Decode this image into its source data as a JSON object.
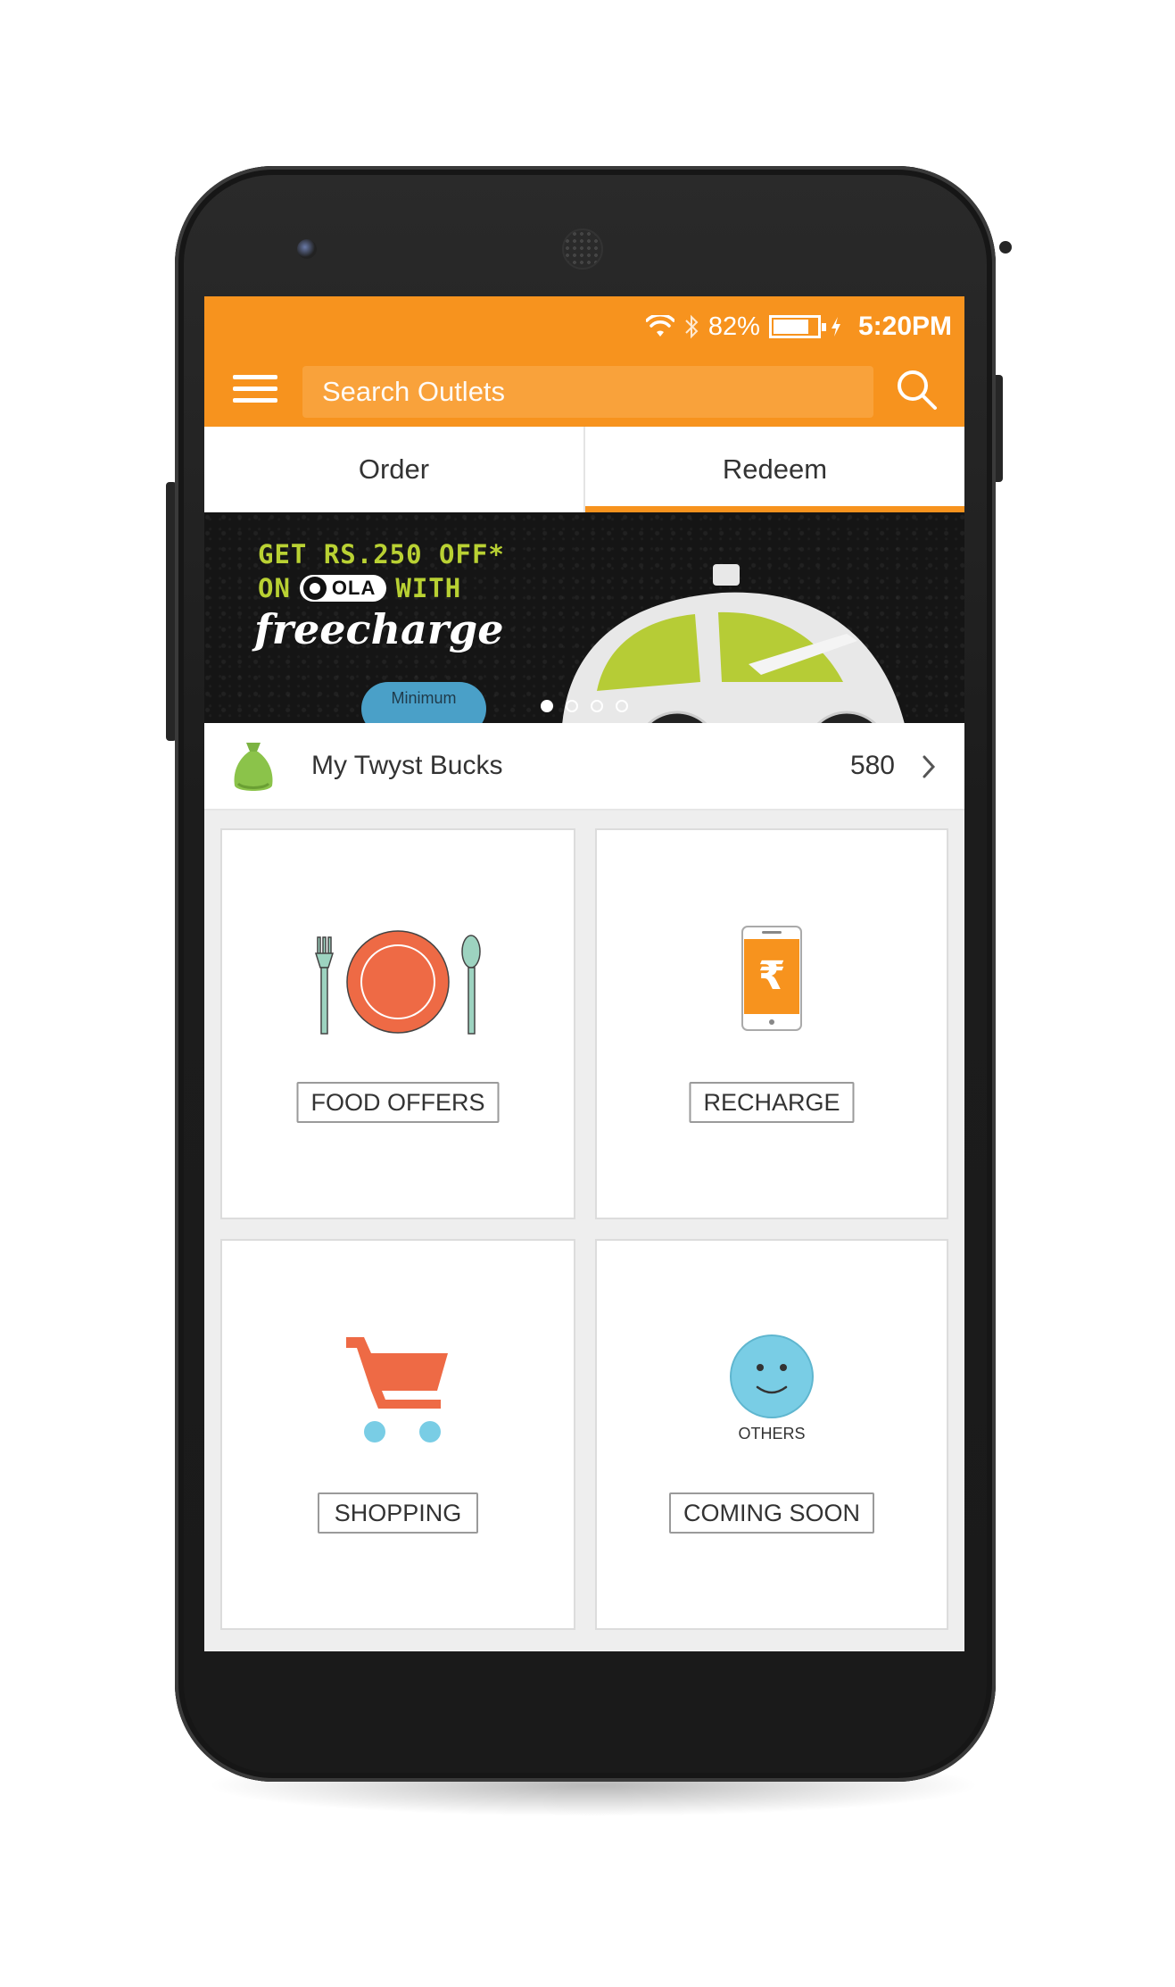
{
  "status_bar": {
    "battery_percent": "82%",
    "battery_level": 0.82,
    "time": "5:20PM",
    "icons": [
      "wifi-icon",
      "bluetooth-icon",
      "battery-icon",
      "charging-icon"
    ]
  },
  "app_bar": {
    "menu_icon": "menu-icon",
    "search_placeholder": "Search Outlets",
    "search_icon": "search-icon"
  },
  "tabs": [
    {
      "label": "Order",
      "active": false
    },
    {
      "label": "Redeem",
      "active": true
    }
  ],
  "banner": {
    "line1": "GET RS.250 OFF*",
    "line2_on": "ON",
    "line2_brand": "OLA",
    "line2_with": "WITH",
    "line3": "freecharge",
    "bubble": "Minimum",
    "slide_count": 4,
    "active_slide": 1
  },
  "bucks": {
    "label": "My Twyst Bucks",
    "value": "580",
    "icon": "money-bag-icon"
  },
  "categories": [
    {
      "label": "FOOD OFFERS",
      "icon": "plate-cutlery-icon"
    },
    {
      "label": "RECHARGE",
      "icon": "mobile-rupee-icon"
    },
    {
      "label": "SHOPPING",
      "icon": "shopping-cart-icon"
    },
    {
      "label": "COMING SOON",
      "icon": "smiley-icon",
      "caption": "OTHERS"
    }
  ],
  "colors": {
    "brand_orange": "#f7931e",
    "accent_red": "#ee6a45",
    "light_blue": "#79cde5",
    "mint": "#9dd3c0"
  }
}
